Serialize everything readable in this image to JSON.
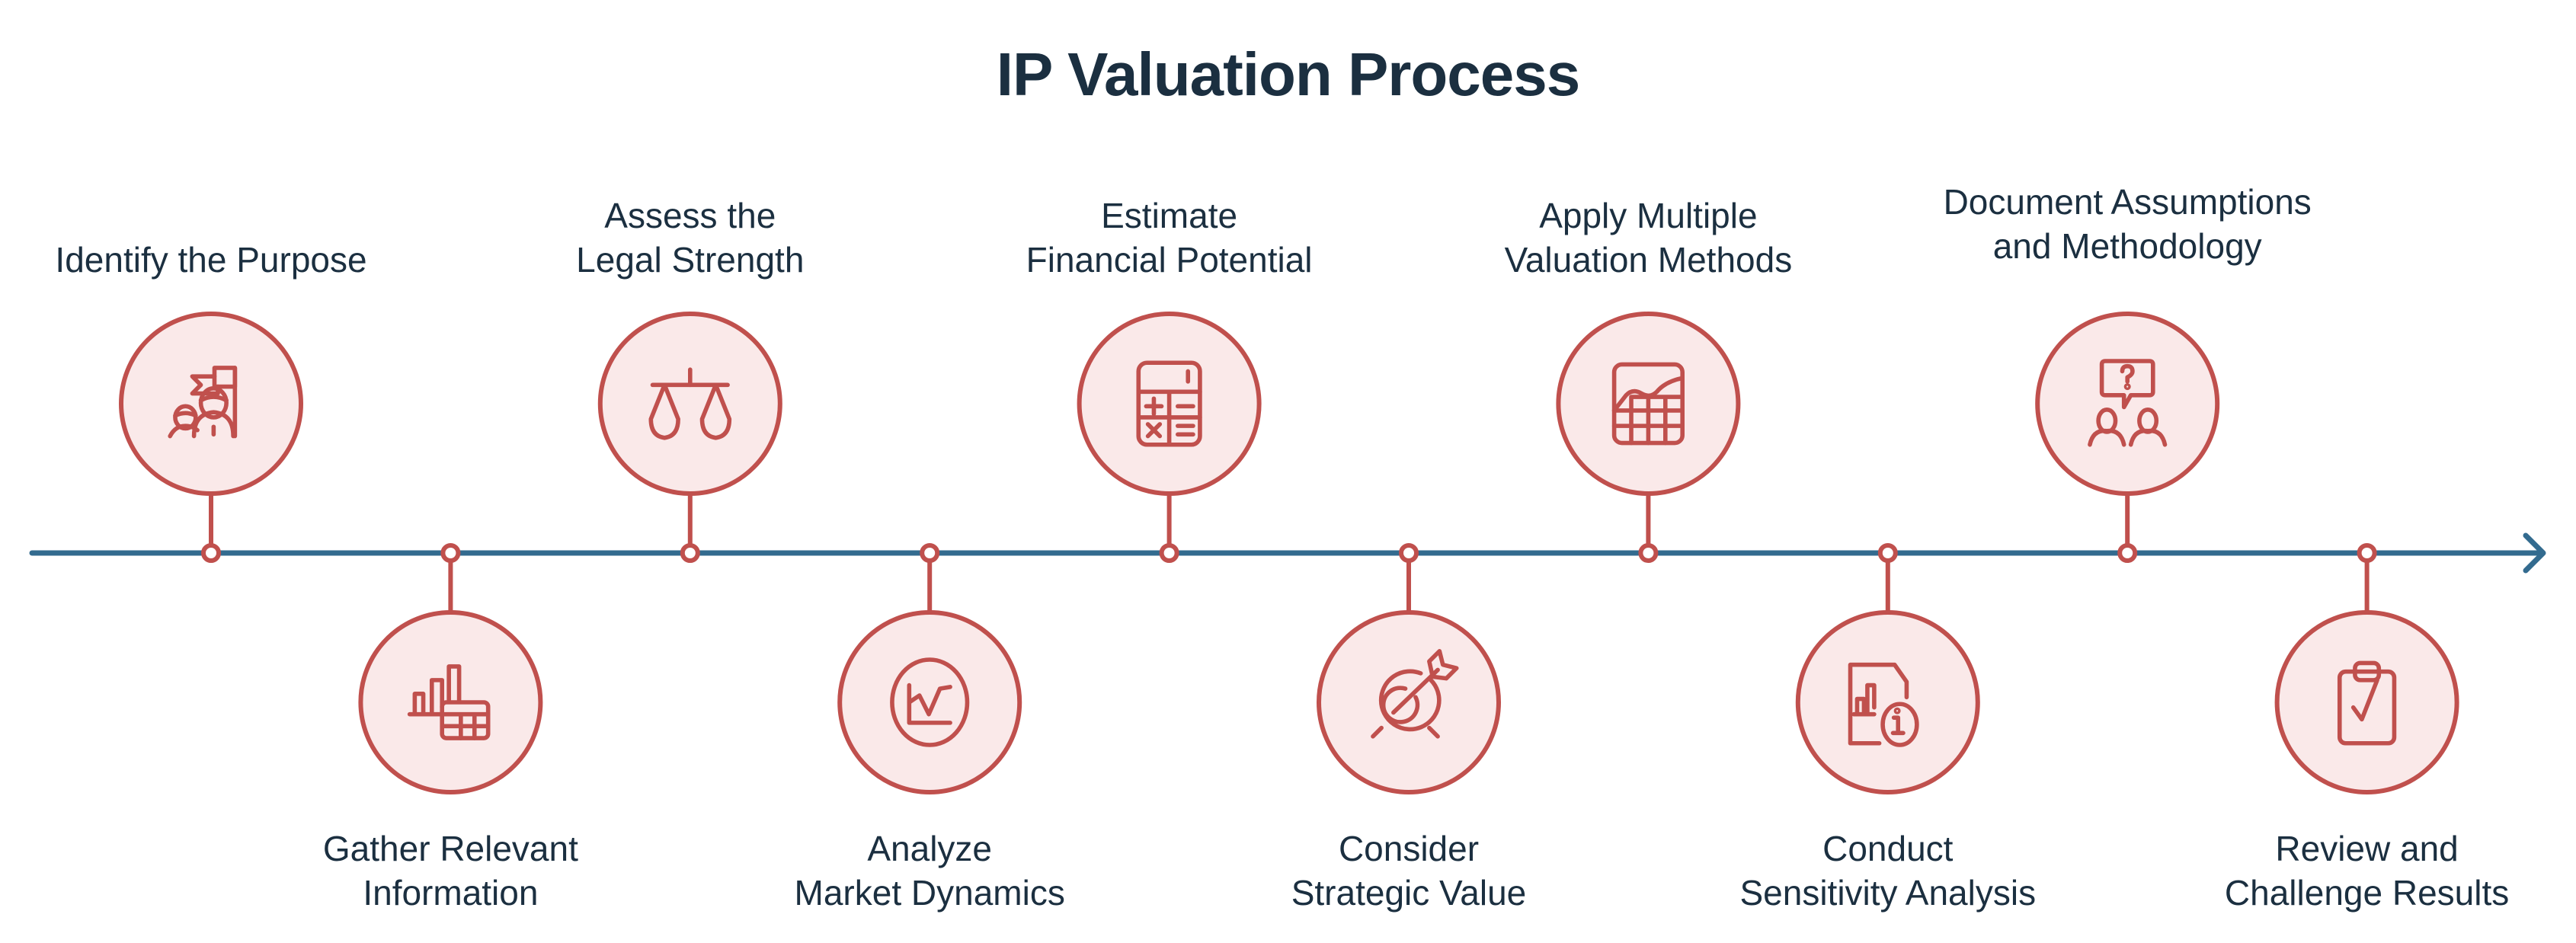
{
  "title": "IP Valuation Process",
  "colors": {
    "title_text": "#1b2f40",
    "label_text": "#1b2f40",
    "timeline": "#336b8f",
    "accent": "#c0504d",
    "icon_fill": "#fae9e9"
  },
  "steps": [
    {
      "order": 1,
      "position": "above",
      "lines": [
        "Identify the Purpose"
      ],
      "icon": "team-flag-icon"
    },
    {
      "order": 2,
      "position": "below",
      "lines": [
        "Gather Relevant",
        "Information"
      ],
      "icon": "bar-chart-table-icon"
    },
    {
      "order": 3,
      "position": "above",
      "lines": [
        "Assess the",
        "Legal Strength"
      ],
      "icon": "scales-icon"
    },
    {
      "order": 4,
      "position": "below",
      "lines": [
        "Analyze",
        "Market Dynamics"
      ],
      "icon": "line-chart-circle-icon"
    },
    {
      "order": 5,
      "position": "above",
      "lines": [
        "Estimate",
        "Financial Potential"
      ],
      "icon": "calculator-icon"
    },
    {
      "order": 6,
      "position": "below",
      "lines": [
        "Consider",
        "Strategic Value"
      ],
      "icon": "target-arrow-icon"
    },
    {
      "order": 7,
      "position": "above",
      "lines": [
        "Apply Multiple",
        "Valuation Methods"
      ],
      "icon": "chart-grid-icon"
    },
    {
      "order": 8,
      "position": "below",
      "lines": [
        "Conduct",
        "Sensitivity Analysis"
      ],
      "icon": "report-info-icon"
    },
    {
      "order": 9,
      "position": "above",
      "lines": [
        "Document Assumptions",
        "and Methodology"
      ],
      "icon": "discussion-question-icon"
    },
    {
      "order": 10,
      "position": "below",
      "lines": [
        "Review and",
        "Challenge Results"
      ],
      "icon": "clipboard-check-icon"
    }
  ]
}
